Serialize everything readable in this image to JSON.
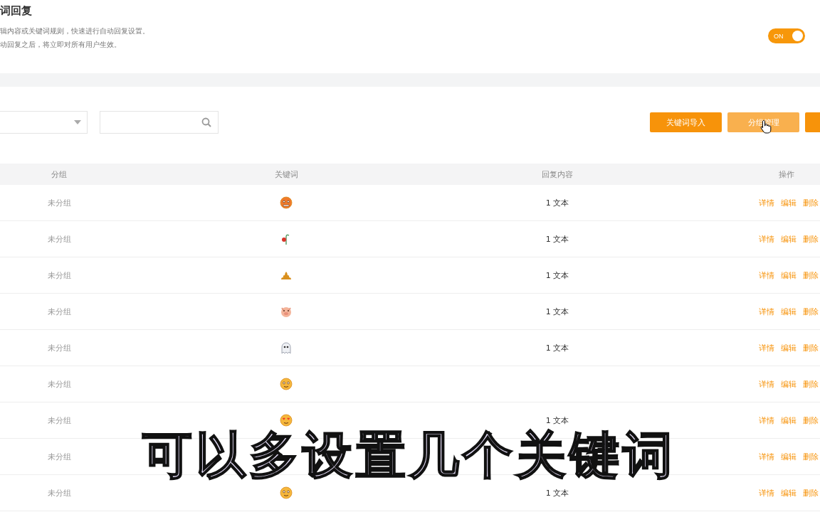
{
  "header": {
    "title": "词回复",
    "description": [
      "辑内容或关键词规则，快速进行自动回复设置。",
      "动回复之后，将立即对所有用户生效。"
    ],
    "toggle": {
      "label": "ON",
      "on": true
    }
  },
  "toolbar": {
    "buttons": [
      {
        "label": "关键词导入",
        "hover": false
      },
      {
        "label": "分组管理",
        "hover": true
      },
      {
        "hover": false
      }
    ]
  },
  "table": {
    "columns": [
      "分组",
      "关键词",
      "回复内容",
      "操作"
    ],
    "rows": [
      {
        "group": "未分组",
        "keyword": {
          "kind": "angry-face"
        },
        "reply": "1 文本",
        "actions": [
          "详情",
          "编辑",
          "删除"
        ]
      },
      {
        "group": "未分组",
        "keyword": {
          "kind": "wilted-rose"
        },
        "reply": "1 文本",
        "actions": [
          "详情",
          "编辑",
          "删除"
        ]
      },
      {
        "group": "未分组",
        "keyword": {
          "kind": "pile"
        },
        "reply": "1 文本",
        "actions": [
          "详情",
          "编辑",
          "删除"
        ]
      },
      {
        "group": "未分组",
        "keyword": {
          "kind": "pig"
        },
        "reply": "1 文本",
        "actions": [
          "详情",
          "编辑",
          "删除"
        ]
      },
      {
        "group": "未分组",
        "keyword": {
          "kind": "ghost"
        },
        "reply": "1 文本",
        "actions": [
          "详情",
          "编辑",
          "删除"
        ]
      },
      {
        "group": "未分组",
        "keyword": {
          "kind": "dizzy-face"
        },
        "actions": [
          "详情",
          "编辑",
          "删除"
        ]
      },
      {
        "group": "未分组",
        "keyword": {
          "kind": "heart-eyes"
        },
        "reply": "1 文本",
        "actions": [
          "详情",
          "编辑",
          "删除"
        ]
      },
      {
        "group": "未分组",
        "actions": [
          "详情",
          "编辑",
          "删除"
        ]
      },
      {
        "group": "未分组",
        "keyword": {
          "kind": "pleading"
        },
        "reply": "1 文本",
        "actions": [
          "详情",
          "编辑",
          "删除"
        ]
      }
    ]
  },
  "caption": "可以多设置几个关键词"
}
